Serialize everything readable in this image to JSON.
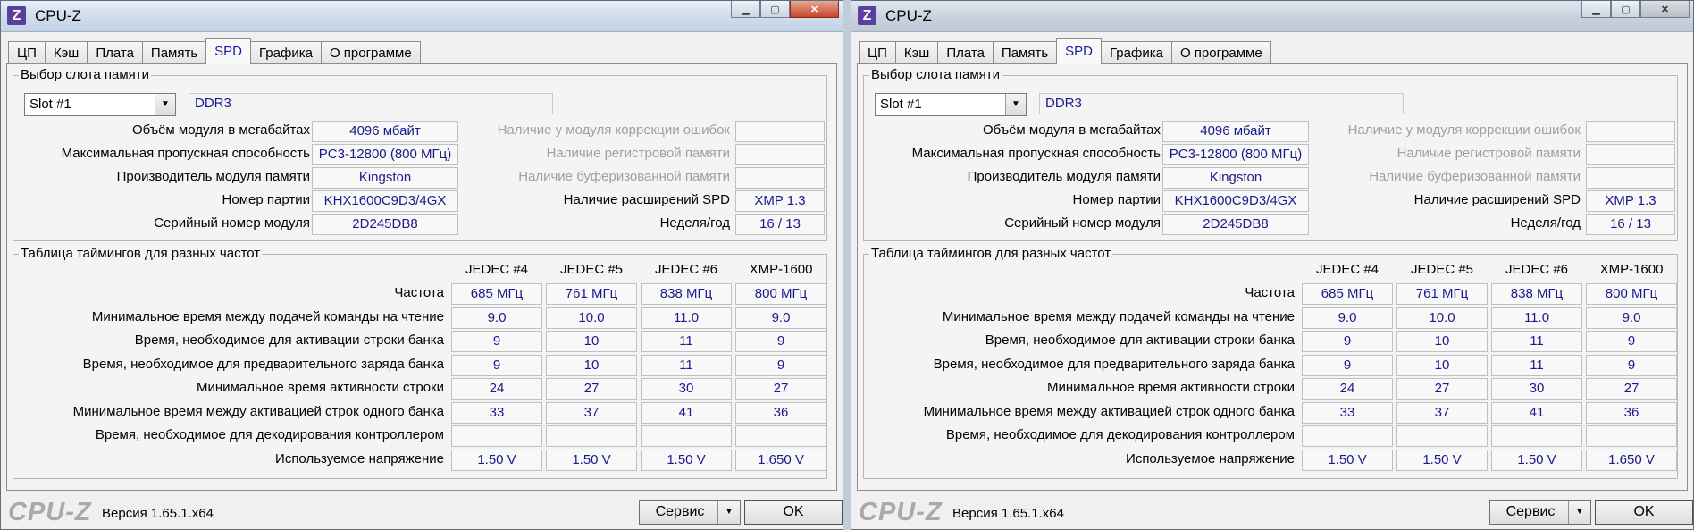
{
  "windows": [
    {
      "title": "CPU-Z",
      "tabs": [
        "ЦП",
        "Кэш",
        "Плата",
        "Память",
        "SPD",
        "Графика",
        "О программе"
      ],
      "active_tab": "SPD",
      "slot_group_title": "Выбор слота памяти",
      "slot_selected": "Slot #1",
      "memory_type": "DDR3",
      "labels": {
        "module_size": "Объём модуля в мегабайтах",
        "max_bandwidth": "Максимальная пропускная способность",
        "manufacturer": "Производитель модуля памяти",
        "part_number": "Номер партии",
        "serial_number": "Серийный номер модуля",
        "ecc": "Наличие у модуля коррекции ошибок",
        "registered": "Наличие регистровой памяти",
        "buffered": "Наличие буферизованной памяти",
        "spd_ext": "Наличие расширений SPD",
        "week_year": "Неделя/год"
      },
      "values": {
        "module_size": "4096 мбайт",
        "max_bandwidth": "PC3-12800 (800 МГц)",
        "manufacturer": "Kingston",
        "part_number": "KHX1600C9D3/4GX",
        "serial_number": "2D245DB8",
        "ecc": "",
        "registered": "",
        "buffered": "",
        "spd_ext": "XMP 1.3",
        "week_year": "16 / 13"
      },
      "timing_group_title": "Таблица таймингов для разных частот",
      "timing_columns": [
        "JEDEC #4",
        "JEDEC #5",
        "JEDEC #6",
        "XMP-1600"
      ],
      "timing_rows": [
        {
          "label": "Частота",
          "values": [
            "685 МГц",
            "761 МГц",
            "838 МГц",
            "800 МГц"
          ]
        },
        {
          "label": "Минимальное время между подачей команды на чтение",
          "values": [
            "9.0",
            "10.0",
            "11.0",
            "9.0"
          ]
        },
        {
          "label": "Время, необходимое для активации строки банка",
          "values": [
            "9",
            "10",
            "11",
            "9"
          ]
        },
        {
          "label": "Время, необходимое для предварительного заряда банка",
          "values": [
            "9",
            "10",
            "11",
            "9"
          ]
        },
        {
          "label": "Минимальное время активности строки",
          "values": [
            "24",
            "27",
            "30",
            "27"
          ]
        },
        {
          "label": "Минимальное время между активацией строк одного банка",
          "values": [
            "33",
            "37",
            "41",
            "36"
          ]
        },
        {
          "label": "Время, необходимое для декодирования контроллером",
          "values": [
            "",
            "",
            "",
            ""
          ]
        },
        {
          "label": "Используемое напряжение",
          "values": [
            "1.50 V",
            "1.50 V",
            "1.50 V",
            "1.650 V"
          ]
        }
      ],
      "logo": "CPU-Z",
      "version": "Версия 1.65.1.x64",
      "service_button": "Сервис",
      "ok_button": "OK"
    },
    {
      "title": "CPU-Z",
      "tabs": [
        "ЦП",
        "Кэш",
        "Плата",
        "Память",
        "SPD",
        "Графика",
        "О программе"
      ],
      "active_tab": "SPD",
      "slot_group_title": "Выбор слота памяти",
      "slot_selected": "Slot #1",
      "memory_type": "DDR3",
      "labels": {
        "module_size": "Объём модуля в мегабайтах",
        "max_bandwidth": "Максимальная пропускная способность",
        "manufacturer": "Производитель модуля памяти",
        "part_number": "Номер партии",
        "serial_number": "Серийный номер модуля",
        "ecc": "Наличие у модуля коррекции ошибок",
        "registered": "Наличие регистровой памяти",
        "buffered": "Наличие буферизованной памяти",
        "spd_ext": "Наличие расширений SPD",
        "week_year": "Неделя/год"
      },
      "values": {
        "module_size": "4096 мбайт",
        "max_bandwidth": "PC3-12800 (800 МГц)",
        "manufacturer": "Kingston",
        "part_number": "KHX1600C9D3/4GX",
        "serial_number": "2D245DB8",
        "ecc": "",
        "registered": "",
        "buffered": "",
        "spd_ext": "XMP 1.3",
        "week_year": "16 / 13"
      },
      "timing_group_title": "Таблица таймингов для разных частот",
      "timing_columns": [
        "JEDEC #4",
        "JEDEC #5",
        "JEDEC #6",
        "XMP-1600"
      ],
      "timing_rows": [
        {
          "label": "Частота",
          "values": [
            "685 МГц",
            "761 МГц",
            "838 МГц",
            "800 МГц"
          ]
        },
        {
          "label": "Минимальное время между подачей команды на чтение",
          "values": [
            "9.0",
            "10.0",
            "11.0",
            "9.0"
          ]
        },
        {
          "label": "Время, необходимое для активации строки банка",
          "values": [
            "9",
            "10",
            "11",
            "9"
          ]
        },
        {
          "label": "Время, необходимое для предварительного заряда банка",
          "values": [
            "9",
            "10",
            "11",
            "9"
          ]
        },
        {
          "label": "Минимальное время активности строки",
          "values": [
            "24",
            "27",
            "30",
            "27"
          ]
        },
        {
          "label": "Минимальное время между активацией строк одного банка",
          "values": [
            "33",
            "37",
            "41",
            "36"
          ]
        },
        {
          "label": "Время, необходимое для декодирования контроллером",
          "values": [
            "",
            "",
            "",
            ""
          ]
        },
        {
          "label": "Используемое напряжение",
          "values": [
            "1.50 V",
            "1.50 V",
            "1.50 V",
            "1.650 V"
          ]
        }
      ],
      "logo": "CPU-Z",
      "version": "Версия 1.65.1.x64",
      "service_button": "Сервис",
      "ok_button": "OK"
    }
  ],
  "colors": {
    "value_text": "#1a1a8a",
    "active_tab_text": "#1a1a9c",
    "disabled_label": "#a0a0a0",
    "logo_gray": "#a9a9a9"
  }
}
